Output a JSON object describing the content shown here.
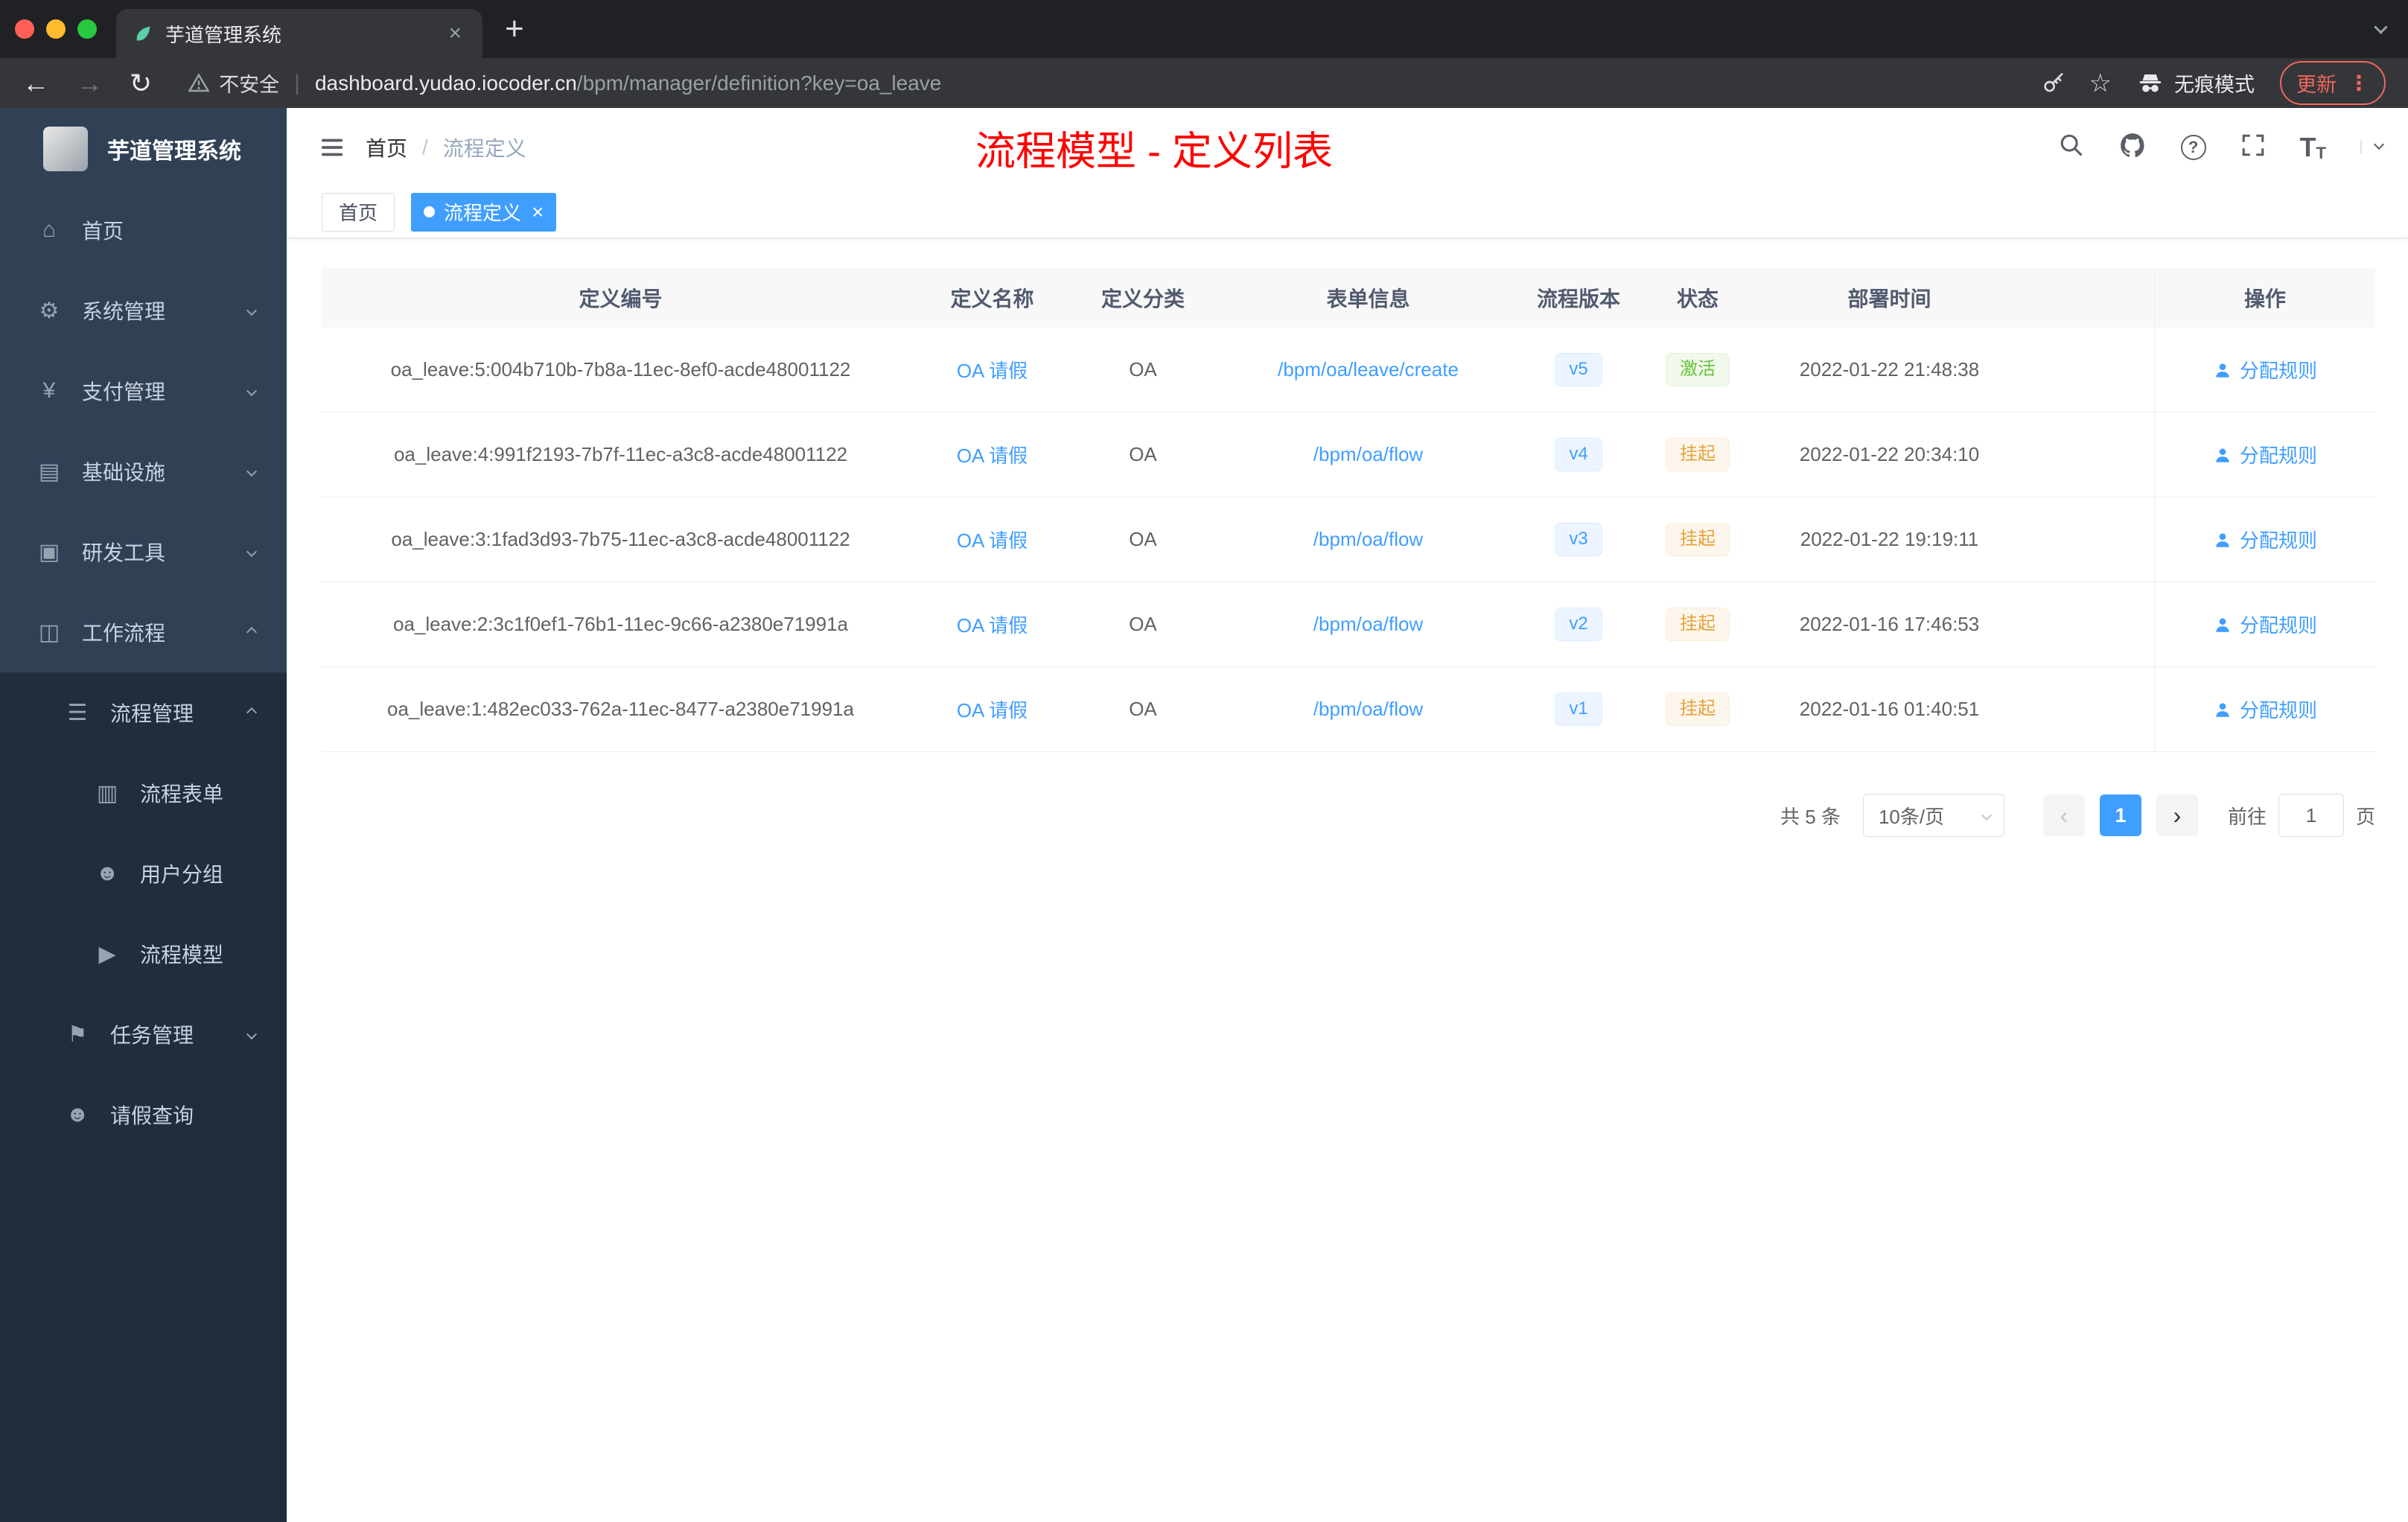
{
  "colors": {
    "accent": "#409eff",
    "success": "#67c23a",
    "warning": "#e6a23c",
    "annotation_red": "#fe0000",
    "sidebar_bg": "#304156",
    "sidebar_sub_bg": "#1f2d3d"
  },
  "browser": {
    "tab": {
      "title": "芋道管理系统",
      "close": "×"
    },
    "new_tab_label": "+",
    "toolbar": {
      "back": "←",
      "forward": "→",
      "reload": "↻",
      "security_label": "不安全",
      "separator": "|",
      "url_domain": "dashboard.yudao.iocoder.cn",
      "url_path": "/bpm/manager/definition?key=oa_leave",
      "star": "☆",
      "incognito_label": "无痕模式",
      "update_label": "更新",
      "menu_dots": "⋮"
    }
  },
  "sidebar": {
    "logo_title": "芋道管理系统",
    "items": [
      {
        "label": "首页",
        "icon": "⌂"
      },
      {
        "label": "系统管理",
        "icon": "⚙"
      },
      {
        "label": "支付管理",
        "icon": "¥"
      },
      {
        "label": "基础设施",
        "icon": "▤"
      },
      {
        "label": "研发工具",
        "icon": "▣"
      },
      {
        "label": "工作流程",
        "icon": "◫"
      },
      {
        "label": "流程管理",
        "icon": "☰"
      },
      {
        "label": "流程表单",
        "icon": "▥"
      },
      {
        "label": "用户分组",
        "icon": "☻"
      },
      {
        "label": "流程模型",
        "icon": "▶"
      },
      {
        "label": "任务管理",
        "icon": "⚑"
      },
      {
        "label": "请假查询",
        "icon": "☻"
      }
    ]
  },
  "header": {
    "breadcrumb_home": "首页",
    "breadcrumb_sep": "/",
    "breadcrumb_current": "流程定义",
    "annotation": "流程模型 - 定义列表",
    "font_size_icon_text": "T"
  },
  "tags": {
    "home": "首页",
    "active": "流程定义",
    "close": "×"
  },
  "table": {
    "columns": [
      "定义编号",
      "定义名称",
      "定义分类",
      "表单信息",
      "流程版本",
      "状态",
      "部署时间",
      "操作"
    ],
    "rows": [
      {
        "id": "oa_leave:5:004b710b-7b8a-11ec-8ef0-acde48001122",
        "name": "OA 请假",
        "category": "OA",
        "form": "/bpm/oa/leave/create",
        "version": "v5",
        "status": "激活",
        "time": "2022-01-22 21:48:38",
        "action": "分配规则"
      },
      {
        "id": "oa_leave:4:991f2193-7b7f-11ec-a3c8-acde48001122",
        "name": "OA 请假",
        "category": "OA",
        "form": "/bpm/oa/flow",
        "version": "v4",
        "status": "挂起",
        "time": "2022-01-22 20:34:10",
        "action": "分配规则"
      },
      {
        "id": "oa_leave:3:1fad3d93-7b75-11ec-a3c8-acde48001122",
        "name": "OA 请假",
        "category": "OA",
        "form": "/bpm/oa/flow",
        "version": "v3",
        "status": "挂起",
        "time": "2022-01-22 19:19:11",
        "action": "分配规则"
      },
      {
        "id": "oa_leave:2:3c1f0ef1-76b1-11ec-9c66-a2380e71991a",
        "name": "OA 请假",
        "category": "OA",
        "form": "/bpm/oa/flow",
        "version": "v2",
        "status": "挂起",
        "time": "2022-01-16 17:46:53",
        "action": "分配规则"
      },
      {
        "id": "oa_leave:1:482ec033-762a-11ec-8477-a2380e71991a",
        "name": "OA 请假",
        "category": "OA",
        "form": "/bpm/oa/flow",
        "version": "v1",
        "status": "挂起",
        "time": "2022-01-16 01:40:51",
        "action": "分配规则"
      }
    ]
  },
  "pagination": {
    "total": "共 5 条",
    "page_size": "10条/页",
    "prev": "‹",
    "next": "›",
    "current": "1",
    "goto_prefix": "前往",
    "goto_value": "1",
    "goto_suffix": "页"
  }
}
